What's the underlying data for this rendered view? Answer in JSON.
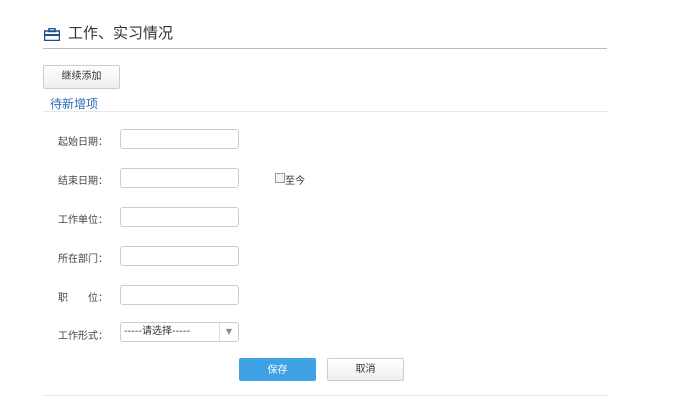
{
  "header": {
    "title": "工作、实习情况",
    "icon": "briefcase-icon"
  },
  "add_more_label": "继续添加",
  "section_title": "待新增项",
  "fields": [
    {
      "label": "起始日期：",
      "value": ""
    },
    {
      "label": "结束日期：",
      "value": ""
    },
    {
      "label": "工作单位：",
      "value": ""
    },
    {
      "label": "所在部门：",
      "value": ""
    },
    {
      "label": "职　　位：",
      "value": ""
    }
  ],
  "until_now_label": "至今",
  "work_type": {
    "label": "工作形式：",
    "selected": "-----请选择-----"
  },
  "save_label": "保存",
  "cancel_label": "取消",
  "colors": {
    "accent": "#3fa2e5",
    "title_blue": "#2a6db5"
  }
}
